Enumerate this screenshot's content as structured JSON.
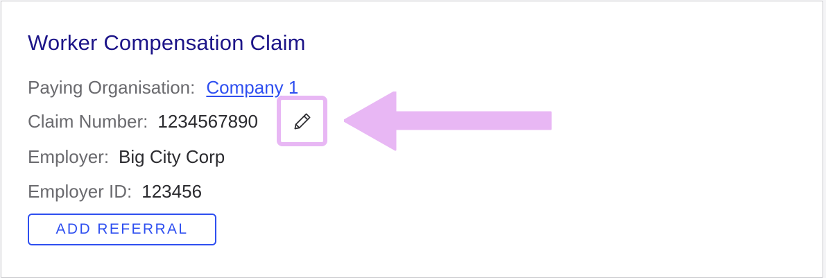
{
  "card": {
    "title": "Worker Compensation Claim",
    "fields": {
      "paying_organisation": {
        "label": "Paying Organisation:",
        "value": "Company 1"
      },
      "claim_number": {
        "label": "Claim Number:",
        "value": "1234567890"
      },
      "employer": {
        "label": "Employer:",
        "value": "Big City Corp"
      },
      "employer_id": {
        "label": "Employer ID:",
        "value": "123456"
      }
    },
    "add_referral_label": "ADD REFERRAL"
  },
  "icons": {
    "edit": "pencil-icon",
    "highlight_arrow": "left-arrow-annotation"
  },
  "colors": {
    "title": "#1c1488",
    "link": "#2e4ff0",
    "label": "#6a6a6e",
    "value": "#2b2b2f",
    "highlight": "#e8b7f4",
    "border": "#c8c8cc"
  }
}
